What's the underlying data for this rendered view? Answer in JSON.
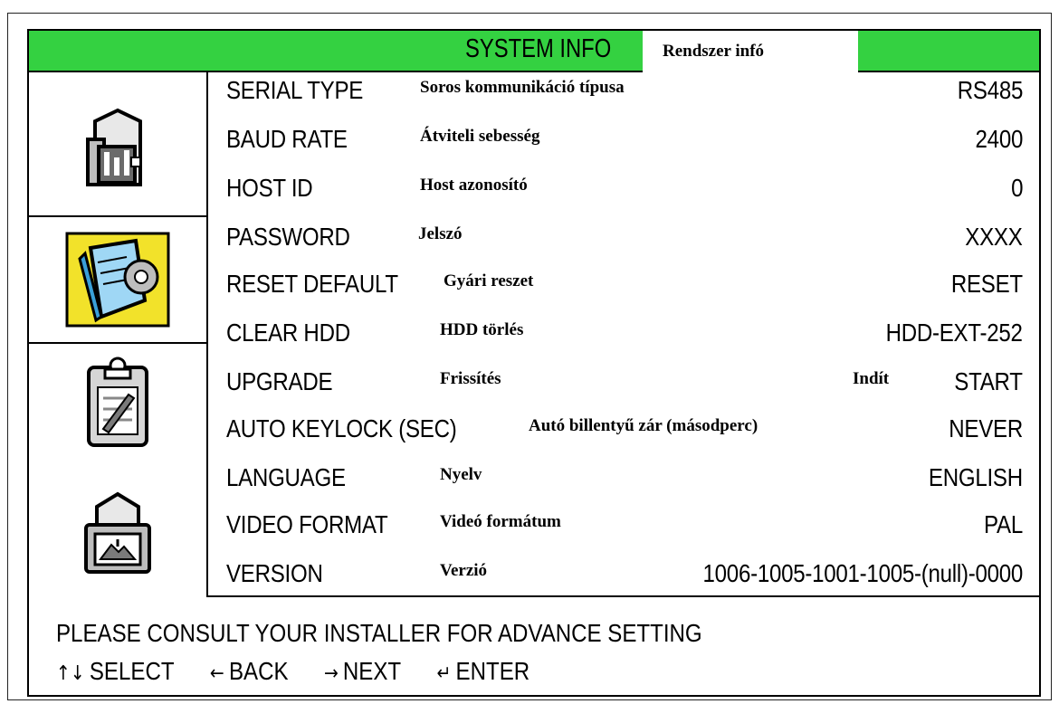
{
  "header": {
    "title": "SYSTEM INFO",
    "translation": "Rendszer infó",
    "color": "#34d141"
  },
  "tabs": [
    {
      "icon": "system-settings-icon",
      "selected": false
    },
    {
      "icon": "manual-book-icon",
      "selected": true
    },
    {
      "icon": "clipboard-record-icon",
      "selected": false
    },
    {
      "icon": "network-icon",
      "selected": false
    }
  ],
  "rows": [
    {
      "label": "SERIAL TYPE",
      "translation": "Soros  kommunikáció típusa",
      "value": "RS485"
    },
    {
      "label": "BAUD RATE",
      "translation": "Átviteli sebesség",
      "value": "2400"
    },
    {
      "label": "HOST ID",
      "translation": "Host azonosító",
      "value": "0"
    },
    {
      "label": "PASSWORD",
      "translation": "Jelszó",
      "value": "XXXX"
    },
    {
      "label": "RESET DEFAULT",
      "translation": "Gyári reszet",
      "value": "RESET"
    },
    {
      "label": "CLEAR HDD",
      "translation": "HDD törlés",
      "value": "HDD-EXT-252"
    },
    {
      "label": "UPGRADE",
      "translation": "Frissítés",
      "value": "START",
      "value_translation": "Indít"
    },
    {
      "label": "AUTO KEYLOCK (SEC)",
      "translation": "Autó billentyű zár (másodperc)",
      "value": "NEVER"
    },
    {
      "label": "LANGUAGE",
      "translation": "Nyelv",
      "value": "ENGLISH"
    },
    {
      "label": "VIDEO FORMAT",
      "translation": "Videó formátum",
      "value": "PAL"
    },
    {
      "label": "VERSION",
      "translation": "Verzió",
      "value": "1006-1005-1001-1005-(null)-0000"
    }
  ],
  "footer": {
    "notice": "PLEASE CONSULT YOUR INSTALLER FOR ADVANCE SETTING",
    "nav": [
      {
        "symbol": "↑↓",
        "label": "SELECT"
      },
      {
        "symbol": "←",
        "label": "BACK"
      },
      {
        "symbol": "→",
        "label": "NEXT"
      },
      {
        "symbol": "↵",
        "label": "ENTER"
      }
    ]
  }
}
